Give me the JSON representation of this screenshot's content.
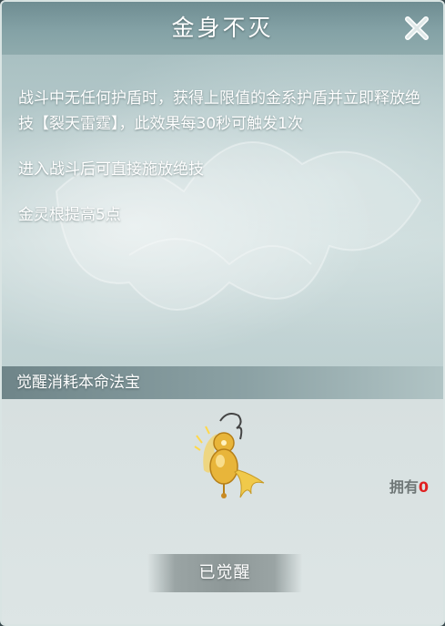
{
  "dialog": {
    "title": "金身不灭",
    "close_icon": "close-icon"
  },
  "description": {
    "lines": [
      "战斗中无任何护盾时，获得上限值的金系护盾并立即释放绝技【裂天雷霆】，此效果每30秒可触发1次",
      "进入战斗后可直接施放绝技",
      "金灵根提高5点"
    ]
  },
  "cost": {
    "label": "觉醒消耗本命法宝",
    "item_icon": "golden-gourd-artifact-icon",
    "owned_label": "拥有",
    "owned_count": "0"
  },
  "action": {
    "awaken_label": "已觉醒"
  },
  "colors": {
    "header": "#7d9a9e",
    "owned_count": "#e02020",
    "artifact_gold": "#e8b53a"
  }
}
